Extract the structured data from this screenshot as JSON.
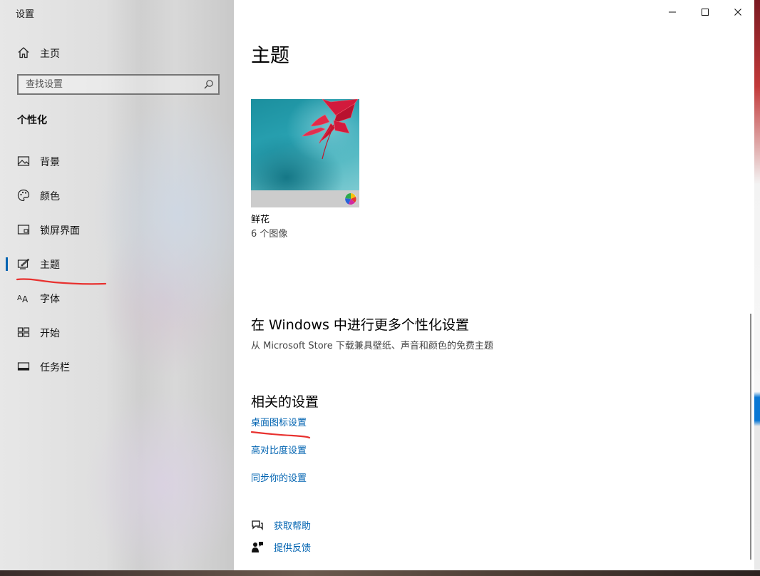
{
  "window": {
    "title": "设置",
    "controls": [
      "minimize",
      "maximize",
      "close"
    ]
  },
  "sidebar": {
    "home_label": "主页",
    "search_placeholder": "查找设置",
    "section_title": "个性化",
    "items": [
      {
        "label": "背景",
        "icon": "picture-icon",
        "active": false
      },
      {
        "label": "颜色",
        "icon": "palette-icon",
        "active": false
      },
      {
        "label": "锁屏界面",
        "icon": "lockscreen-icon",
        "active": false
      },
      {
        "label": "主题",
        "icon": "theme-icon",
        "active": true
      },
      {
        "label": "字体",
        "icon": "font-icon",
        "active": false
      },
      {
        "label": "开始",
        "icon": "start-icon",
        "active": false
      },
      {
        "label": "任务栏",
        "icon": "taskbar-icon",
        "active": false
      }
    ]
  },
  "main": {
    "page_title": "主题",
    "theme": {
      "name": "鲜花",
      "count": "6 个图像"
    },
    "more_section": {
      "title": "在 Windows 中进行更多个性化设置",
      "subtitle": "从 Microsoft Store 下载兼具壁纸、声音和颜色的免费主题"
    },
    "related": {
      "title": "相关的设置",
      "links": [
        "桌面图标设置",
        "高对比度设置",
        "同步你的设置"
      ]
    },
    "help": {
      "get_help": "获取帮助",
      "feedback": "提供反馈"
    }
  },
  "colors": {
    "accent": "#0063b1",
    "annotation": "#e8312f"
  }
}
